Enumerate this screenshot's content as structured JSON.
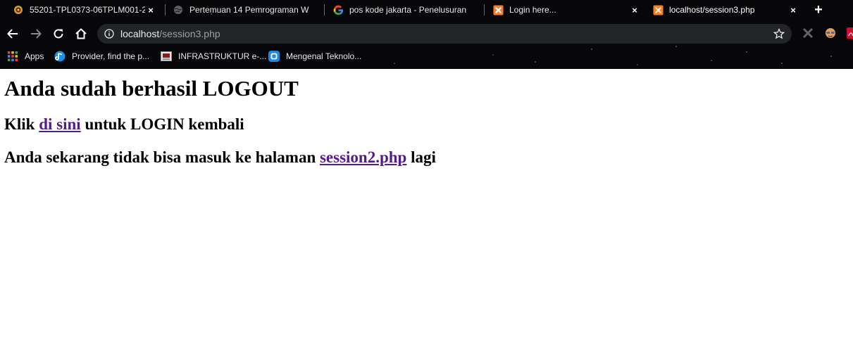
{
  "browser": {
    "tabs": [
      {
        "title": "55201-TPL0373-06TPLM001-20",
        "close": "×",
        "favicon": "university-seal-icon",
        "active": false
      },
      {
        "title": "Pertemuan 14 Pemrograman W",
        "close": "×",
        "favicon": "globe-icon",
        "active": false
      },
      {
        "title": "pos kode jakarta - Penelusuran",
        "close": "×",
        "favicon": "google-g-icon",
        "active": false
      },
      {
        "title": "Login here...",
        "close": "×",
        "favicon": "xampp-icon",
        "active": false
      },
      {
        "title": "localhost/session3.php",
        "close": "×",
        "favicon": "xampp-icon",
        "active": true
      }
    ],
    "new_tab_label": "+",
    "address": {
      "host": "localhost",
      "path": "/session3.php"
    },
    "bookmarks": [
      {
        "label": "Apps",
        "icon": "apps-grid-icon"
      },
      {
        "label": "Provider, find the p...",
        "icon": "provider-icon"
      },
      {
        "label": "INFRASTRUKTUR e-...",
        "icon": "document-icon"
      },
      {
        "label": "Mengenal Teknolo...",
        "icon": "tech-site-icon"
      }
    ],
    "colors": {
      "tab_bar": "#070709",
      "omnibox": "#232428",
      "xampp": "#fb7a24"
    }
  },
  "page": {
    "heading": "Anda sudah berhasil LOGOUT",
    "line1": {
      "before": "Klik ",
      "link": "di sini",
      "after": " untuk LOGIN kembali"
    },
    "line2": {
      "before": "Anda sekarang tidak bisa masuk ke halaman ",
      "link": "session2.php",
      "after": " lagi"
    },
    "link_color": "#551a8b"
  }
}
